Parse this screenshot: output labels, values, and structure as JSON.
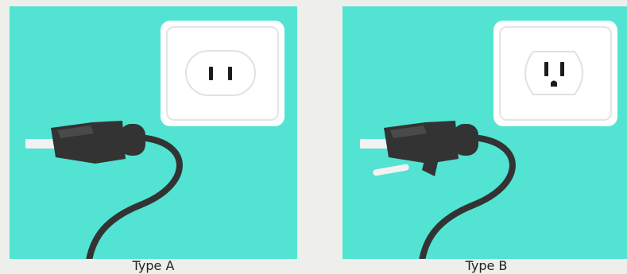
{
  "colors": {
    "background": "#eeeeeb",
    "panel": "#52e3d2",
    "outlet_plate": "#ffffff",
    "outlet_border": "#e4e4e4",
    "plug_body": "#333333",
    "plug_highlight": "#4a4a4a",
    "cable": "#333333",
    "prong": "#f2f2f2",
    "slot": "#1c1c1c"
  },
  "panels": [
    {
      "caption": "Type A",
      "icon": "type-a-plug-and-outlet",
      "outlet": "two-slot-outlet-icon",
      "plug": "two-prong-plug-icon"
    },
    {
      "caption": "Type B",
      "icon": "type-b-plug-and-outlet",
      "outlet": "three-slot-grounded-outlet-icon",
      "plug": "three-prong-plug-icon"
    }
  ]
}
